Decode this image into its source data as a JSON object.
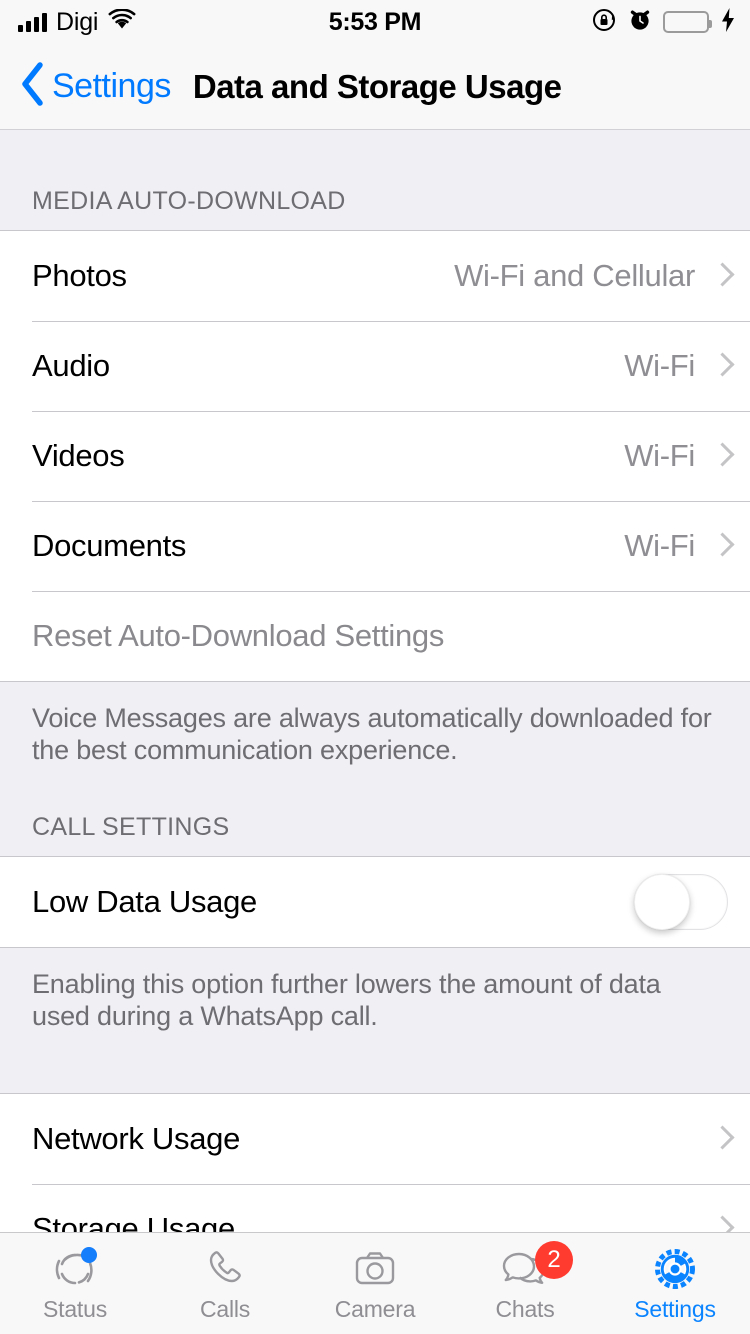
{
  "status_bar": {
    "carrier": "Digi",
    "time": "5:53 PM",
    "signal_bars": 4,
    "wifi_icon": "wifi-icon",
    "rotation_lock_icon": "rotation-lock-icon",
    "alarm_icon": "alarm-clock-icon",
    "battery_icon": "battery-icon",
    "charging_icon": "lightning-bolt-icon",
    "battery_color": "#4CD964"
  },
  "nav": {
    "back_label": "Settings",
    "back_icon": "chevron-left-icon",
    "title": "Data and Storage Usage",
    "accent_color": "#007AFF"
  },
  "sections": {
    "media": {
      "header": "MEDIA AUTO-DOWNLOAD",
      "rows": [
        {
          "label": "Photos",
          "value": "Wi-Fi and Cellular"
        },
        {
          "label": "Audio",
          "value": "Wi-Fi"
        },
        {
          "label": "Videos",
          "value": "Wi-Fi"
        },
        {
          "label": "Documents",
          "value": "Wi-Fi"
        }
      ],
      "reset_label": "Reset Auto-Download Settings",
      "footnote": "Voice Messages are always automatically downloaded for the best communication experience."
    },
    "call_settings": {
      "header": "CALL SETTINGS",
      "low_data_label": "Low Data Usage",
      "low_data_enabled": false,
      "footnote": "Enabling this option further lowers the amount of data used during a WhatsApp call."
    },
    "usage": {
      "rows": [
        {
          "label": "Network Usage"
        },
        {
          "label": "Storage Usage"
        }
      ]
    }
  },
  "tabbar": {
    "items": [
      {
        "label": "Status",
        "icon": "status-rings-icon",
        "active": false,
        "dot": true,
        "badge": null
      },
      {
        "label": "Calls",
        "icon": "phone-icon",
        "active": false,
        "dot": false,
        "badge": null
      },
      {
        "label": "Camera",
        "icon": "camera-icon",
        "active": false,
        "dot": false,
        "badge": null
      },
      {
        "label": "Chats",
        "icon": "chat-bubbles-icon",
        "active": false,
        "dot": false,
        "badge": "2"
      },
      {
        "label": "Settings",
        "icon": "gear-icon",
        "active": true,
        "dot": false,
        "badge": null
      }
    ],
    "active_color": "#0b84ff",
    "inactive_color": "#8E8E93",
    "badge_color": "#FF3B30"
  }
}
